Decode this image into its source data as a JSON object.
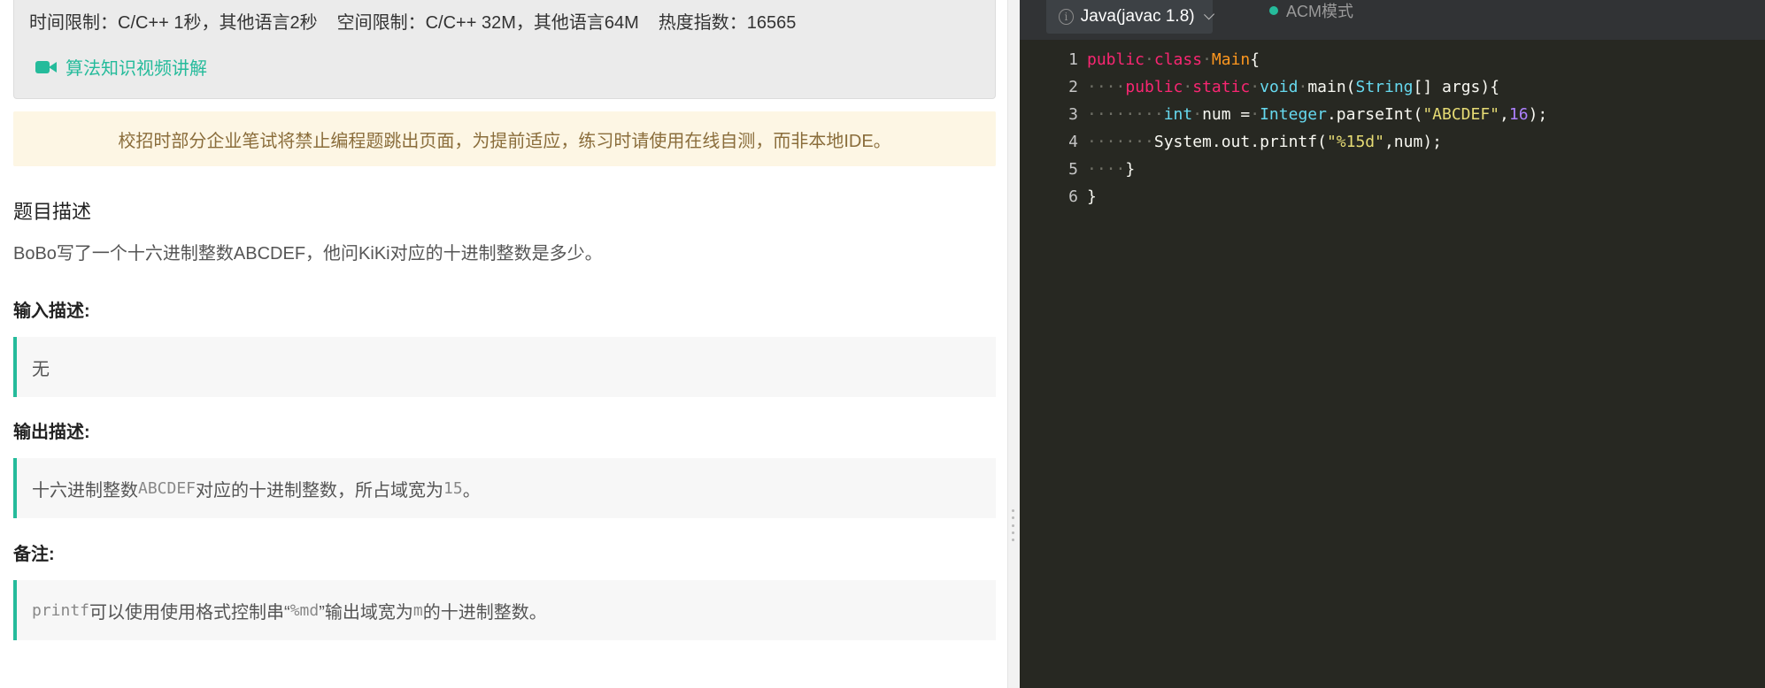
{
  "problem": {
    "limits": {
      "time": "时间限制：C/C++ 1秒，其他语言2秒",
      "space": "空间限制：C/C++ 32M，其他语言64M",
      "heat": "热度指数：16565"
    },
    "video_link": "算法知识视频讲解",
    "notice": "校招时部分企业笔试将禁止编程题跳出页面，为提前适应，练习时请使用在线自测，而非本地IDE。",
    "desc_title": "题目描述",
    "description": "BoBo写了一个十六进制整数ABCDEF，他问KiKi对应的十进制整数是多少。",
    "input_label": "输入描述:",
    "input_text": "无",
    "output_label": "输出描述:",
    "output_pre": "十六进制整数",
    "output_code1": "ABCDEF",
    "output_mid": "对应的十进制整数，所占域宽为",
    "output_code2": "15",
    "output_end": "。",
    "note_label": "备注:",
    "note_code1": "printf",
    "note_mid1": "可以使用使用格式控制串“",
    "note_code2": "%md",
    "note_mid2": "”输出域宽为",
    "note_code3": "m",
    "note_end": "的十进制整数。"
  },
  "editor": {
    "language": "Java(javac 1.8)",
    "mode": "ACM模式",
    "line_numbers": [
      "1",
      "2",
      "3",
      "4",
      "5",
      "6"
    ],
    "tokens": {
      "public": "public",
      "class": "class",
      "main_cls": "Main",
      "brace_open": "{",
      "static": "static",
      "void": "void",
      "main_fn": "main(",
      "string_t": "String",
      "args": "[] args){",
      "int_t": "int",
      "num_eq": "num =",
      "integer_t": "Integer",
      "parse": ".parseInt(",
      "str_abc": "\"ABCDEF\"",
      "comma": ",",
      "n16": "16",
      "close": ");",
      "printf": "System.out.printf(",
      "str_fmt": "\"%15d\"",
      "printf_args": ",num);",
      "brace_close": "}"
    }
  }
}
